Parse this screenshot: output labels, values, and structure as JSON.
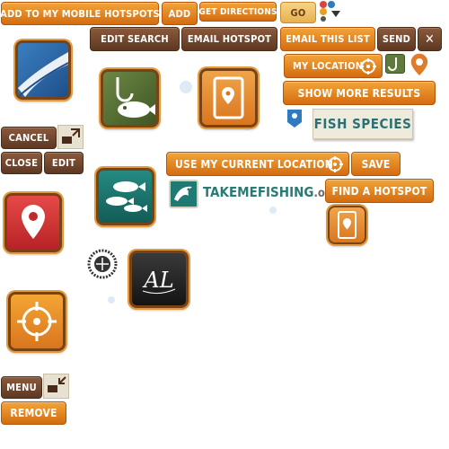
{
  "buttons": {
    "add_to_hotspots": "ADD TO MY MOBILE HOTSPOTS",
    "add": "ADD",
    "get_directions": "GET DIRECTIONS",
    "go": "GO",
    "edit_search": "EDIT SEARCH",
    "email_hotspot": "EMAIL HOTSPOT",
    "email_list": "EMAIL THIS LIST",
    "send": "SEND",
    "close_x": "✕",
    "my_location": "MY LOCATION",
    "show_more": "SHOW MORE RESULTS",
    "cancel": "CANCEL",
    "close": "CLOSE",
    "edit": "EDIT",
    "use_location": "USE MY CURRENT LOCATION",
    "save": "SAVE",
    "find_hotspot": "FIND A HOTSPOT",
    "menu": "MENU",
    "remove": "REMOVE"
  },
  "labels": {
    "fish_species": "FISH SPECIES",
    "takemefishing": "TAKEMEFISHING",
    "takemefishing_suffix": ".org"
  },
  "icons": [
    "road-icon",
    "fishhook-icon",
    "map-pin-icon",
    "fish-school-icon",
    "location-pin-icon",
    "target-icon",
    "al-logo-icon",
    "stamp-logo-icon",
    "expand-icon",
    "collapse-icon",
    "crosshair-icon",
    "dolphin-icon"
  ],
  "colors": {
    "orange": "#e08422",
    "brown": "#6e4329",
    "frame": "#7a4316",
    "red": "#d8343a",
    "teal": "#1e7a73",
    "green": "#55733a"
  }
}
